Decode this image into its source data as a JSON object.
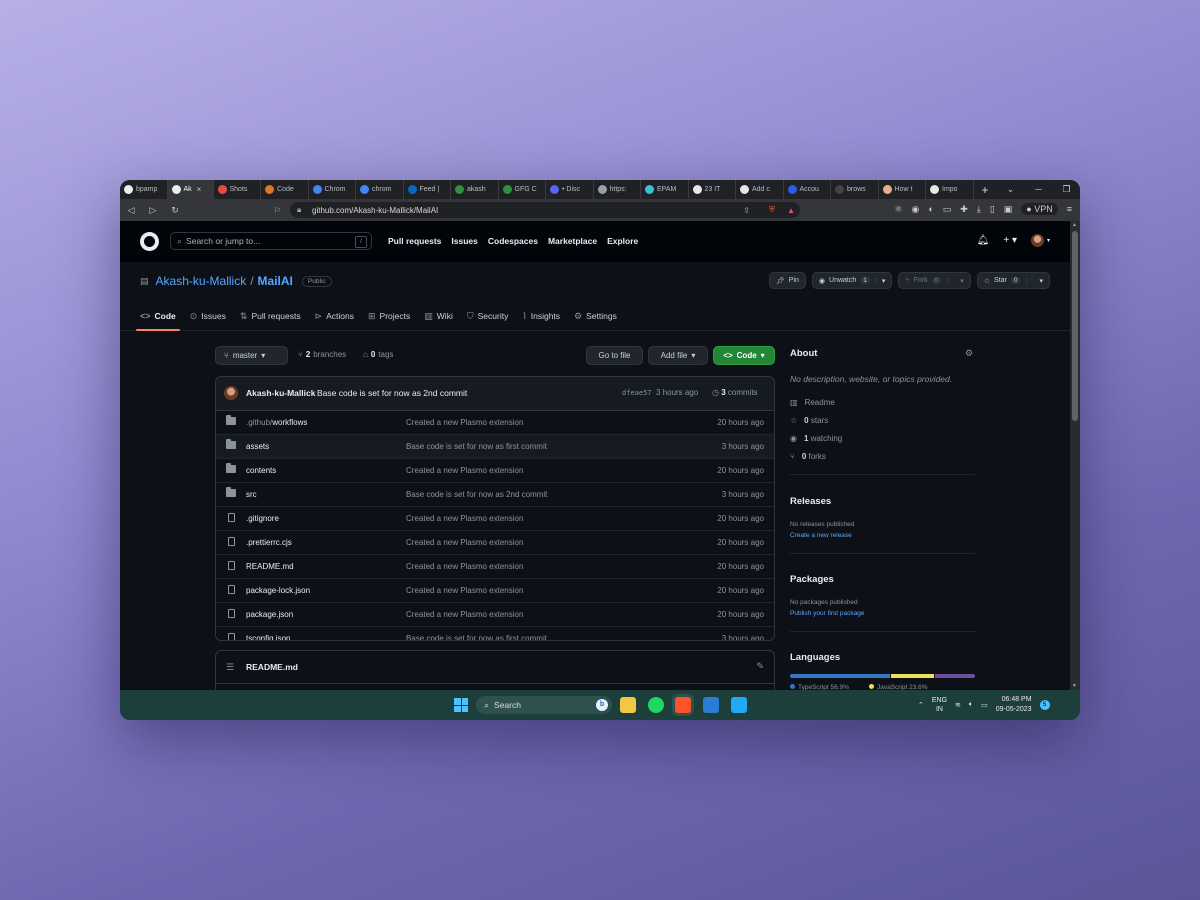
{
  "browser": {
    "tabs": [
      {
        "label": "bpamp",
        "color": "#e6edf3"
      },
      {
        "label": "Ak",
        "color": "#e6edf3",
        "active": true
      },
      {
        "label": "Shots",
        "color": "#e84a4a"
      },
      {
        "label": "Code",
        "color": "#e0752a"
      },
      {
        "label": "Chrom",
        "color": "#4285f4"
      },
      {
        "label": "chrom",
        "color": "#4285f4"
      },
      {
        "label": "Feed |",
        "color": "#0a66c2"
      },
      {
        "label": "akash",
        "color": "#2f8d46"
      },
      {
        "label": "GFG C",
        "color": "#2f8d46"
      },
      {
        "label": "• Disc",
        "color": "#5865f2"
      },
      {
        "label": "https:",
        "color": "#9aa0a6"
      },
      {
        "label": "EPAM",
        "color": "#39c2d7"
      },
      {
        "label": "23 IT",
        "color": "#e6e6e6"
      },
      {
        "label": "Add c",
        "color": "#e6e6e6"
      },
      {
        "label": "Accou",
        "color": "#2d5be3"
      },
      {
        "label": "brows",
        "color": "#444444"
      },
      {
        "label": "How t",
        "color": "#e0b090"
      },
      {
        "label": "Impo",
        "color": "#e6e6e6"
      }
    ],
    "url": "github.com/Akash-ku-Mallick/MailAI",
    "vpn": "VPN"
  },
  "gh": {
    "search_placeholder": "Search or jump to...",
    "slash": "/",
    "nav": [
      "Pull requests",
      "Issues",
      "Codespaces",
      "Marketplace",
      "Explore"
    ],
    "plus": "+ ▾"
  },
  "repo": {
    "owner": "Akash-ku-Mallick",
    "sep": "/",
    "name": "MailAI",
    "visibility": "Public",
    "pin": "Pin",
    "unwatch": "Unwatch",
    "watch_count": "1",
    "fork": "Fork",
    "fork_count": "0",
    "star": "Star",
    "star_count": "0",
    "tabs": [
      "Code",
      "Issues",
      "Pull requests",
      "Actions",
      "Projects",
      "Wiki",
      "Security",
      "Insights",
      "Settings"
    ]
  },
  "toolbar": {
    "branch": "master",
    "branches_count": "2",
    "branches_label": "branches",
    "tags_count": "0",
    "tags_label": "tags",
    "goto": "Go to file",
    "addfile": "Add file",
    "code": "Code"
  },
  "commit": {
    "author": "Akash-ku-Mallick",
    "message": "Base code is set for now as 2nd commit",
    "sha": "dfeae57",
    "time": "3 hours ago",
    "count": "3",
    "count_label": "commits"
  },
  "files": [
    {
      "dim": ".github/",
      "name": "workflows",
      "type": "folder",
      "msg": "Created a new Plasmo extension",
      "time": "20 hours ago"
    },
    {
      "dim": "",
      "name": "assets",
      "type": "folder",
      "msg": "Base code is set for now as first commit",
      "time": "3 hours ago"
    },
    {
      "dim": "",
      "name": "contents",
      "type": "folder",
      "msg": "Created a new Plasmo extension",
      "time": "20 hours ago"
    },
    {
      "dim": "",
      "name": "src",
      "type": "folder",
      "msg": "Base code is set for now as 2nd commit",
      "time": "3 hours ago"
    },
    {
      "dim": "",
      "name": ".gitignore",
      "type": "file",
      "msg": "Created a new Plasmo extension",
      "time": "20 hours ago"
    },
    {
      "dim": "",
      "name": ".prettierrc.cjs",
      "type": "file",
      "msg": "Created a new Plasmo extension",
      "time": "20 hours ago"
    },
    {
      "dim": "",
      "name": "README.md",
      "type": "file",
      "msg": "Created a new Plasmo extension",
      "time": "20 hours ago"
    },
    {
      "dim": "",
      "name": "package-lock.json",
      "type": "file",
      "msg": "Created a new Plasmo extension",
      "time": "20 hours ago"
    },
    {
      "dim": "",
      "name": "package.json",
      "type": "file",
      "msg": "Created a new Plasmo extension",
      "time": "20 hours ago"
    },
    {
      "dim": "",
      "name": "tsconfig.json",
      "type": "file",
      "msg": "Base code is set for now as first commit",
      "time": "3 hours ago"
    }
  ],
  "readme": {
    "title": "README.md"
  },
  "about": {
    "title": "About",
    "desc": "No description, website, or topics provided.",
    "readme": "Readme",
    "stars_count": "0",
    "stars_label": "stars",
    "watching_count": "1",
    "watching_label": "watching",
    "forks_count": "0",
    "forks_label": "forks",
    "releases_title": "Releases",
    "releases_none": "No releases published",
    "releases_link": "Create a new release",
    "packages_title": "Packages",
    "packages_none": "No packages published",
    "packages_link": "Publish your first package",
    "languages_title": "Languages",
    "lang1": "TypeScript 56.9%",
    "lang2": "JavaScript 23.6%",
    "lang_colors": [
      "#3178c6",
      "#f1e05a",
      "#6e4c9e"
    ],
    "lang_shares": [
      0.546,
      0.236,
      0.218
    ]
  },
  "taskbar": {
    "search": "Search",
    "lang_top": "ENG",
    "lang_bottom": "IN",
    "time": "06:48 PM",
    "date": "09-05-2023",
    "notif": "5"
  }
}
